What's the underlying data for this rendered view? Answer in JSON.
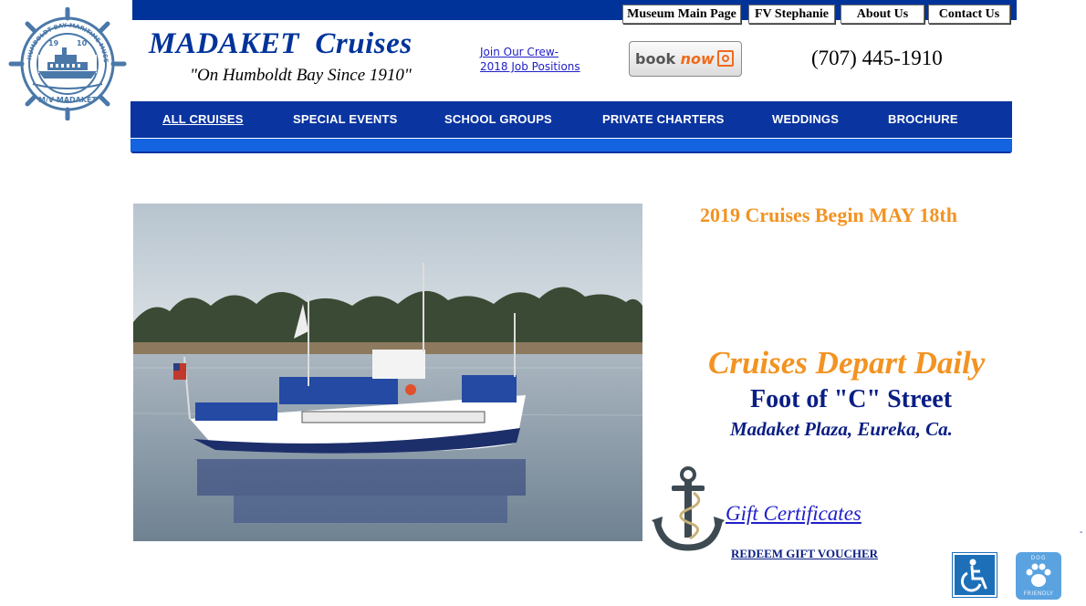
{
  "logo": {
    "ring_text_top": "HUMBOLDT BAY MARITIME MUSEUM",
    "year_left": "19",
    "year_right": "10",
    "ring_text_bottom": "M/V MADAKET"
  },
  "topnav": [
    {
      "label": "Museum Main Page"
    },
    {
      "label": "FV Stephanie"
    },
    {
      "label": "About Us"
    },
    {
      "label": "Contact Us"
    }
  ],
  "brand": {
    "title": "MADAKET  Cruises",
    "tagline": "\"On Humboldt Bay Since 1910\""
  },
  "crew_link": {
    "line1": "Join Our Crew-",
    "line2": "2018 Job Positions"
  },
  "book_button": {
    "word1": "book",
    "word2": "now"
  },
  "phone": "(707) 445-1910",
  "mainnav": [
    {
      "label": "ALL CRUISES"
    },
    {
      "label": "SPECIAL EVENTS"
    },
    {
      "label": "SCHOOL GROUPS"
    },
    {
      "label": "PRIVATE CHARTERS"
    },
    {
      "label": "WEDDINGS"
    },
    {
      "label": "BROCHURE"
    }
  ],
  "announcement": "2019 Cruises Begin MAY 18th",
  "depart": {
    "headline": "Cruises Depart Daily",
    "street": "Foot of \"C\" Street",
    "plaza": "Madaket Plaza, Eureka, Ca."
  },
  "gift_link": "Gift Certificates",
  "redeem_link": "REDEEM GIFT VOUCHER",
  "stray_mark": "-",
  "dog_badge": {
    "top": "DOG",
    "bottom": "FRIENDLY"
  },
  "colors": {
    "nav_blue": "#0a34a0",
    "topbar_blue": "#00339a",
    "accent_orange": "#f29322",
    "heading_navy": "#0a1e84",
    "link_blue": "#2020c8"
  },
  "icons": [
    "ship-wheel-logo",
    "book-now-icon",
    "anchor-icon",
    "wheelchair-icon",
    "dog-paw-icon"
  ]
}
